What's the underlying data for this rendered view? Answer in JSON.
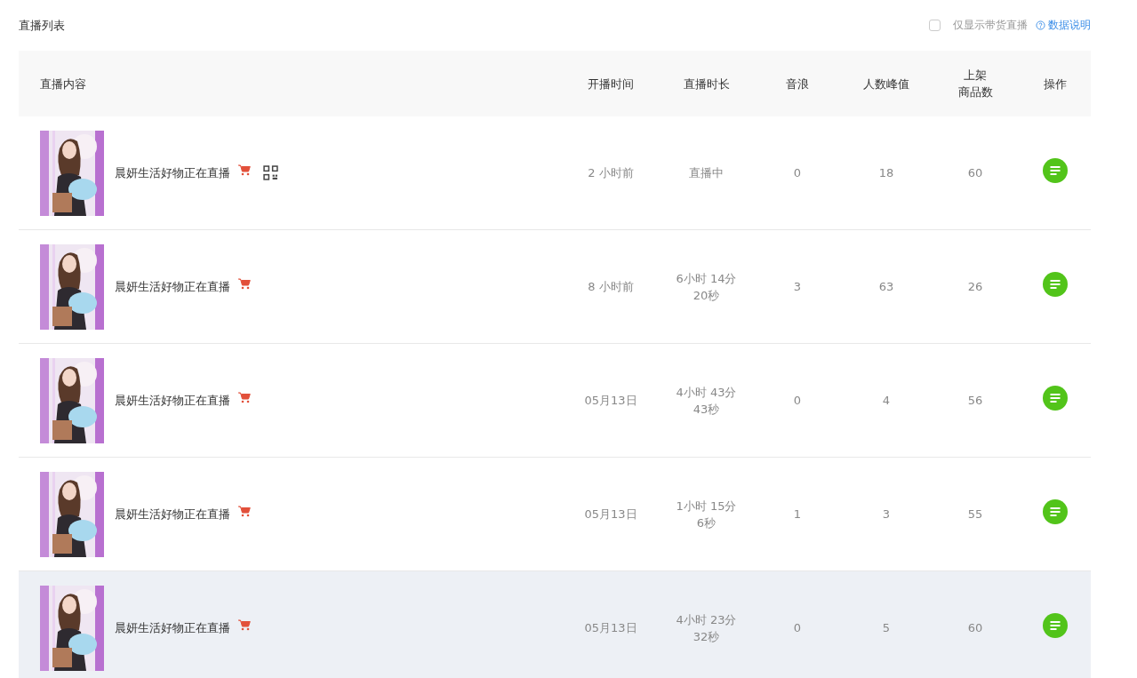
{
  "title": "直播列表",
  "filter": {
    "label": "仅显示带货直播",
    "checked": false
  },
  "help_link": "数据说明",
  "table": {
    "columns": [
      [
        "直播内容"
      ],
      [
        "开播时间"
      ],
      [
        "直播时长"
      ],
      [
        "音浪"
      ],
      [
        "人数峰值"
      ],
      [
        "上架",
        "商品数"
      ],
      [
        "操作"
      ]
    ],
    "rows": [
      {
        "title": "晨妍生活好物正在直播",
        "qr_code": true,
        "start": "2 小时前",
        "duration": [
          "直播中"
        ],
        "yinlang": "0",
        "peak": "18",
        "goods": "60",
        "selected": false
      },
      {
        "title": "晨妍生活好物正在直播",
        "qr_code": false,
        "start": "8 小时前",
        "duration": [
          "6小时 14分",
          "20秒"
        ],
        "yinlang": "3",
        "peak": "63",
        "goods": "26",
        "selected": false
      },
      {
        "title": "晨妍生活好物正在直播",
        "qr_code": false,
        "start": "05月13日",
        "duration": [
          "4小时 43分",
          "43秒"
        ],
        "yinlang": "0",
        "peak": "4",
        "goods": "56",
        "selected": false
      },
      {
        "title": "晨妍生活好物正在直播",
        "qr_code": false,
        "start": "05月13日",
        "duration": [
          "1小时 15分",
          "6秒"
        ],
        "yinlang": "1",
        "peak": "3",
        "goods": "55",
        "selected": false
      },
      {
        "title": "晨妍生活好物正在直播",
        "qr_code": false,
        "start": "05月13日",
        "duration": [
          "4小时 23分",
          "32秒"
        ],
        "yinlang": "0",
        "peak": "5",
        "goods": "60",
        "selected": true
      }
    ]
  }
}
